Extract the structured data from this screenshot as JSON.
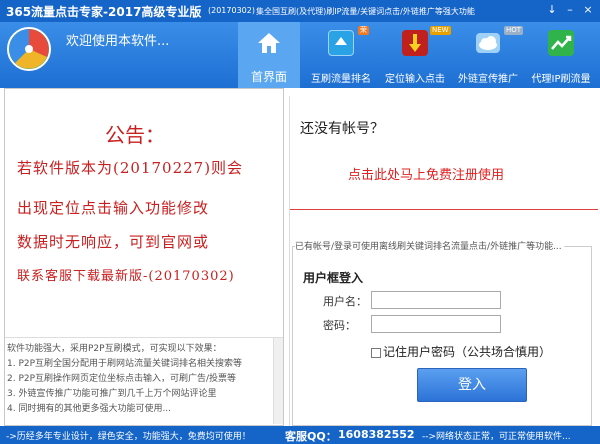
{
  "window": {
    "title": "365流量点击专家-2017高级专业版",
    "version": "(20170302)",
    "description": "集全国互刷(及代理)刷IP流量/关键词点击/外链推广等强大功能",
    "controls": [
      "↓",
      "–",
      "×"
    ]
  },
  "header": {
    "welcome": "欢迎使用本软件...",
    "nav": [
      {
        "label": "首界面",
        "icon": "home-icon"
      },
      {
        "label": "互刷流量排名",
        "icon": "rank-up-icon",
        "badge": "荣"
      },
      {
        "label": "定位输入点击",
        "icon": "cursor-click-icon",
        "badge": "NEW"
      },
      {
        "label": "外链宣传推广",
        "icon": "cloud-icon",
        "badge": "HOT"
      },
      {
        "label": "代理IP刷流量",
        "icon": "chart-up-icon"
      }
    ]
  },
  "notice": {
    "title": "公告：",
    "lines": [
      "若软件版本为(20170227)则会",
      "出现定位点击输入功能修改",
      "数据时无响应，可到官网或",
      "联系客服下载最新版-(20170302)"
    ],
    "features": [
      "软件功能强大，采用P2P互刷模式，可实现以下效果：",
      "1. P2P互刷全国分配用于刷网站流量关键词排名相关搜索等",
      "2. P2P互刷操作网页定位坐标点击输入，可刷广告/投票等",
      "3. 外链宣传推广功能可推广到几千上万个网站评论里",
      "4. 同时拥有的其他更多强大功能可使用..."
    ]
  },
  "account": {
    "no_account": "还没有帐号？",
    "register_link": "点击此处马上免费注册使用",
    "login_hint": "已有帐号/登录可使用离线刷关键词排名流量点击/外链推广等功能...",
    "login_title": "用户框登入",
    "username_label": "用户名：",
    "username_value": "",
    "password_label": "密码：",
    "password_value": "",
    "remember_label": "记住用户密码（公共场合慎用）",
    "login_button": "登入"
  },
  "statusbar": {
    "left": "->历经多年专业设计，绿色安全，功能强大，免费均可使用！",
    "qq_label": "客服QQ：",
    "qq_number": "1608382552",
    "right": "-->网络状态正常，可正常使用软件..."
  }
}
